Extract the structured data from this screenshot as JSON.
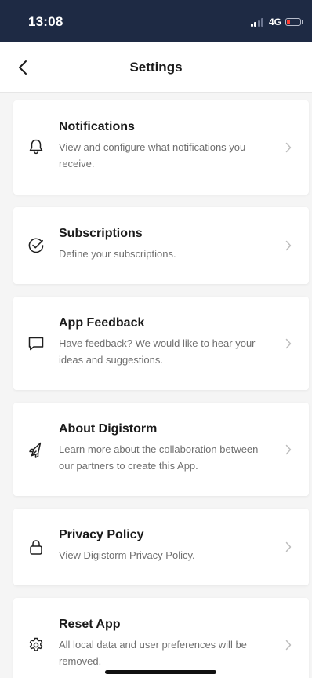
{
  "status_bar": {
    "time": "13:08",
    "network": "4G",
    "battery_color": "#ff3b30"
  },
  "nav": {
    "title": "Settings",
    "back_icon": "chevron-left-icon"
  },
  "colors": {
    "header_bg": "#1e2a44",
    "page_bg": "#f5f5f5",
    "card_bg": "#ffffff",
    "title_text": "#1a1a1a",
    "desc_text": "#6f6f6f"
  },
  "items": [
    {
      "title": "Notifications",
      "description": "View and configure what notifications you receive.",
      "icon": "bell-icon"
    },
    {
      "title": "Subscriptions",
      "description": "Define your subscriptions.",
      "icon": "check-circle-icon"
    },
    {
      "title": "App Feedback",
      "description": "Have feedback? We would like to hear your ideas and suggestions.",
      "icon": "chat-bubble-icon"
    },
    {
      "title": "About Digistorm",
      "description": "Learn more about the collaboration between our partners to create this App.",
      "icon": "rocket-icon"
    },
    {
      "title": "Privacy Policy",
      "description": "View Digistorm Privacy Policy.",
      "icon": "lock-icon"
    },
    {
      "title": "Reset App",
      "description": "All local data and user preferences will be removed.",
      "icon": "gear-icon"
    }
  ]
}
